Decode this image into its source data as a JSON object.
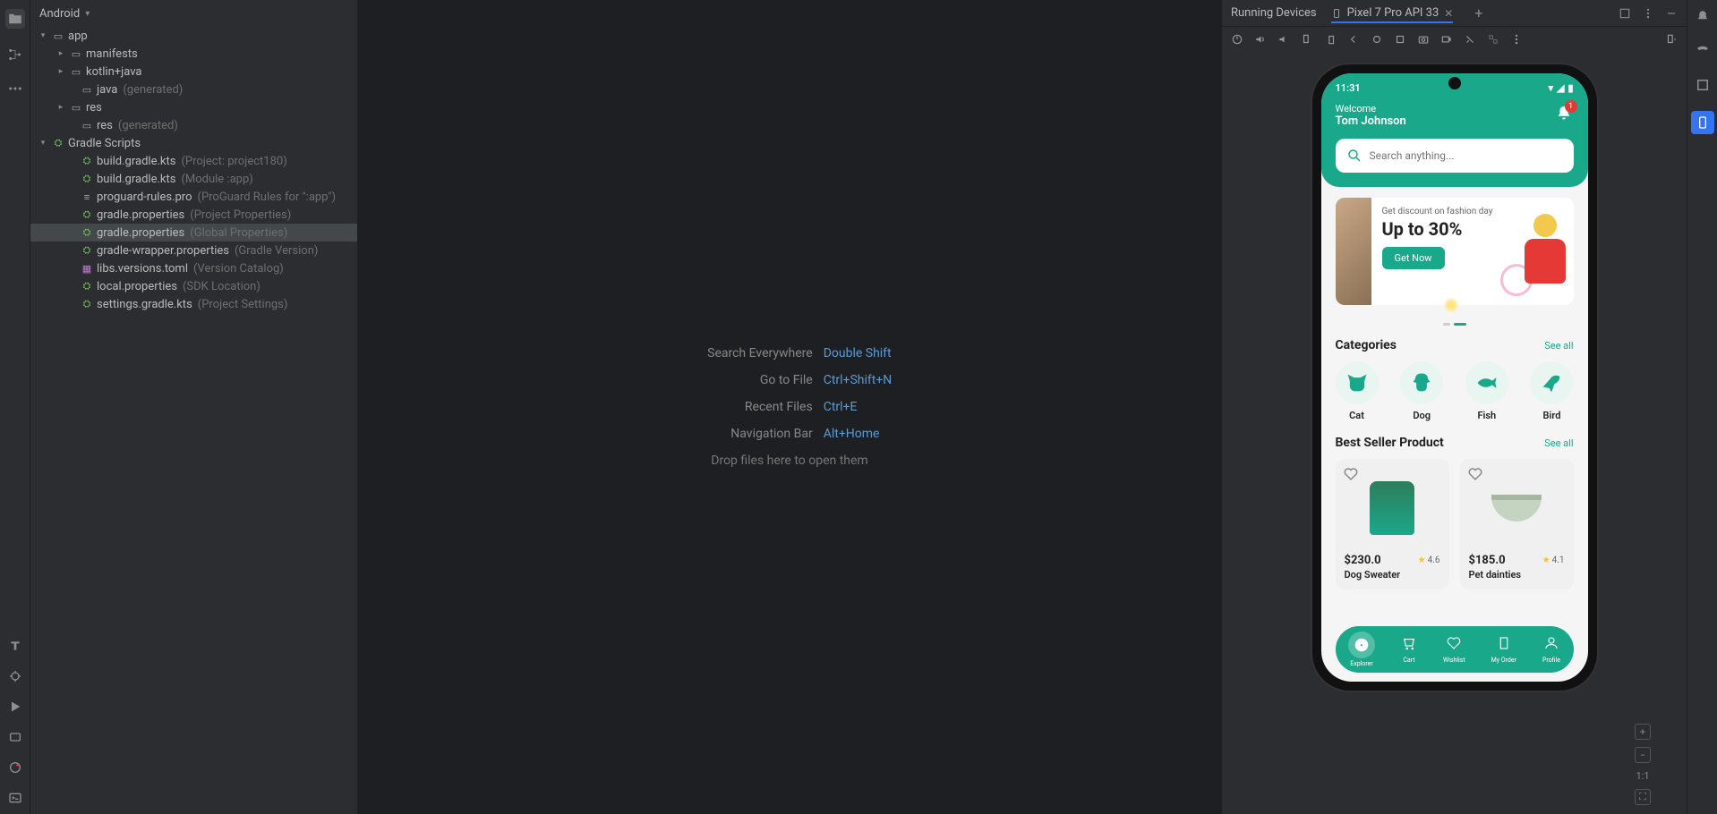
{
  "panel": {
    "title": "Android"
  },
  "tree": {
    "app": "app",
    "manifests": "manifests",
    "kotlinjava": "kotlin+java",
    "java_gen": "java",
    "java_gen_hint": "(generated)",
    "res": "res",
    "res_gen": "res",
    "res_gen_hint": "(generated)",
    "gradle_scripts": "Gradle Scripts",
    "build_gradle_proj": "build.gradle.kts",
    "build_gradle_proj_hint": "(Project: project180)",
    "build_gradle_app": "build.gradle.kts",
    "build_gradle_app_hint": "(Module :app)",
    "proguard": "proguard-rules.pro",
    "proguard_hint": "(ProGuard Rules for \":app\")",
    "gradle_props_proj": "gradle.properties",
    "gradle_props_proj_hint": "(Project Properties)",
    "gradle_props_glob": "gradle.properties",
    "gradle_props_glob_hint": "(Global Properties)",
    "gradle_wrapper": "gradle-wrapper.properties",
    "gradle_wrapper_hint": "(Gradle Version)",
    "libs_versions": "libs.versions.toml",
    "libs_versions_hint": "(Version Catalog)",
    "local_props": "local.properties",
    "local_props_hint": "(SDK Location)",
    "settings_gradle": "settings.gradle.kts",
    "settings_gradle_hint": "(Project Settings)"
  },
  "hints": {
    "search_label": "Search Everywhere",
    "search_shortcut": "Double Shift",
    "gotofile_label": "Go to File",
    "gotofile_shortcut": "Ctrl+Shift+N",
    "recent_label": "Recent Files",
    "recent_shortcut": "Ctrl+E",
    "nav_label": "Navigation Bar",
    "nav_shortcut": "Alt+Home",
    "drop": "Drop files here to open them"
  },
  "device": {
    "running_label": "Running Devices",
    "tab_name": "Pixel 7 Pro API 33"
  },
  "app": {
    "status_time": "11:31",
    "welcome": "Welcome",
    "user_name": "Tom Johnson",
    "badge_count": "1",
    "search_placeholder": "Search anything...",
    "promo_sub": "Get discount on fashion day",
    "promo_title": "Up to 30%",
    "promo_btn": "Get Now",
    "categories_title": "Categories",
    "see_all": "See all",
    "cats": {
      "cat": "Cat",
      "dog": "Dog",
      "fish": "Fish",
      "bird": "Bird"
    },
    "bestseller_title": "Best Seller Product",
    "products": [
      {
        "price": "$230.0",
        "rating": "4.6",
        "name": "Dog Sweater"
      },
      {
        "price": "$185.0",
        "rating": "4.1",
        "name": "Pet dainties"
      }
    ],
    "nav": {
      "explorer": "Explorer",
      "cart": "Cart",
      "wishlist": "Wishlist",
      "order": "My Order",
      "profile": "Profile"
    }
  },
  "zoom": {
    "ratio": "1:1"
  }
}
